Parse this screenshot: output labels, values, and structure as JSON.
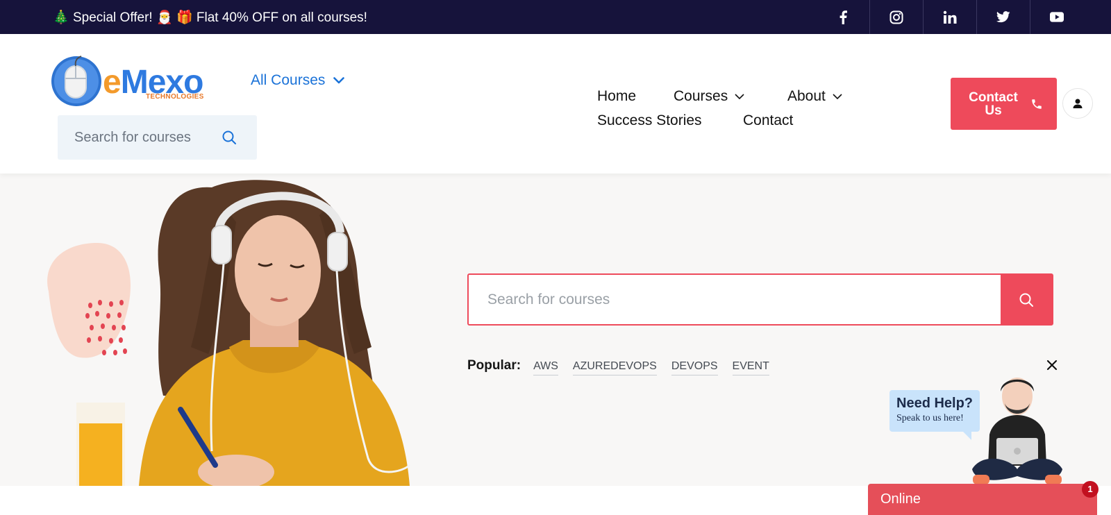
{
  "topbar": {
    "promo_text": "Special Offer!    Flat 40% OFF on all courses!",
    "promo_emoji_tree": "🎄",
    "promo_emoji_santa": "🎅",
    "promo_emoji_gift": "🎁",
    "promo_line_prefix": "Special Offer!",
    "promo_line_suffix": "Flat 40% OFF on all courses!",
    "social_icons": [
      "facebook-icon",
      "instagram-icon",
      "linkedin-icon",
      "twitter-icon",
      "youtube-icon"
    ]
  },
  "header": {
    "logo_word_e": "e",
    "logo_word_rest": "Mexo",
    "logo_sub": "TECHNOLOGIES",
    "all_courses_label": "All Courses",
    "search_placeholder": "Search for courses",
    "nav": {
      "home": "Home",
      "courses": "Courses",
      "about": "About",
      "success": "Success Stories",
      "contact": "Contact"
    },
    "contact_button": "Contact Us"
  },
  "hero": {
    "search_placeholder": "Search for courses",
    "popular_label": "Popular:",
    "popular_tags": [
      "AWS",
      "AZUREDEVOPS",
      "DEVOPS",
      "EVENT"
    ]
  },
  "chat": {
    "help_title": "Need Help?",
    "help_sub": "Speak to us here!",
    "online_label": "Online",
    "badge_count": "1"
  },
  "colors": {
    "topbar_bg": "#16133b",
    "accent": "#ee4a5b",
    "link_blue": "#1a72d8",
    "hero_bg": "#f8f7f6"
  }
}
